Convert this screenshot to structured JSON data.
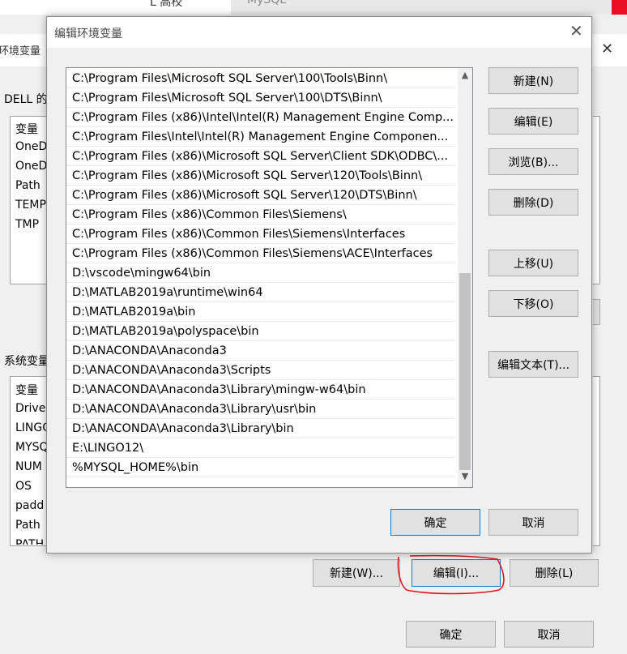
{
  "browser": {
    "tab1_text": "L 高校",
    "tab2_text": "MySQL"
  },
  "background_window": {
    "title": "环境变量",
    "user_section_label": "DELL 的",
    "user_vars": {
      "header": "变量",
      "items": [
        "OneD",
        "OneD",
        "Path",
        "TEMP",
        "TMP"
      ]
    },
    "system_section_label": "系统变量",
    "system_vars": {
      "header": "变量",
      "items": [
        "Drive",
        "LINGO",
        "MYSQ",
        "NUM",
        "OS",
        "padd",
        "Path",
        "PATH"
      ]
    },
    "buttons": {
      "new": "新建(W)...",
      "edit": "编辑(I)...",
      "delete": "删除(L)",
      "ok": "确定",
      "cancel": "取消"
    }
  },
  "dialog": {
    "title": "编辑环境变量",
    "paths": [
      "C:\\Program Files\\Microsoft SQL Server\\100\\Tools\\Binn\\",
      "C:\\Program Files\\Microsoft SQL Server\\100\\DTS\\Binn\\",
      "C:\\Program Files (x86)\\Intel\\Intel(R) Management Engine Comp...",
      "C:\\Program Files\\Intel\\Intel(R) Management Engine Componen...",
      "C:\\Program Files (x86)\\Microsoft SQL Server\\Client SDK\\ODBC\\...",
      "C:\\Program Files (x86)\\Microsoft SQL Server\\120\\Tools\\Binn\\",
      "C:\\Program Files (x86)\\Microsoft SQL Server\\120\\DTS\\Binn\\",
      "C:\\Program Files (x86)\\Common Files\\Siemens\\",
      "C:\\Program Files (x86)\\Common Files\\Siemens\\Interfaces",
      "C:\\Program Files (x86)\\Common Files\\Siemens\\ACE\\Interfaces",
      "D:\\vscode\\mingw64\\bin",
      "D:\\MATLAB2019a\\runtime\\win64",
      "D:\\MATLAB2019a\\bin",
      "D:\\MATLAB2019a\\polyspace\\bin",
      "D:\\ANACONDA\\Anaconda3",
      "D:\\ANACONDA\\Anaconda3\\Scripts",
      "D:\\ANACONDA\\Anaconda3\\Library\\mingw-w64\\bin",
      "D:\\ANACONDA\\Anaconda3\\Library\\usr\\bin",
      "D:\\ANACONDA\\Anaconda3\\Library\\bin",
      "E:\\LINGO12\\",
      "%MYSQL_HOME%\\bin"
    ],
    "buttons": {
      "new": "新建(N)",
      "edit": "编辑(E)",
      "browse": "浏览(B)...",
      "delete": "删除(D)",
      "move_up": "上移(U)",
      "move_down": "下移(O)",
      "edit_text": "编辑文本(T)...",
      "ok": "确定",
      "cancel": "取消"
    }
  },
  "colors": {
    "annotation_red": "#e0141e",
    "close_red": "#e81123",
    "button_face": "#e1e1e1",
    "window_bg": "#f0f0f0"
  }
}
